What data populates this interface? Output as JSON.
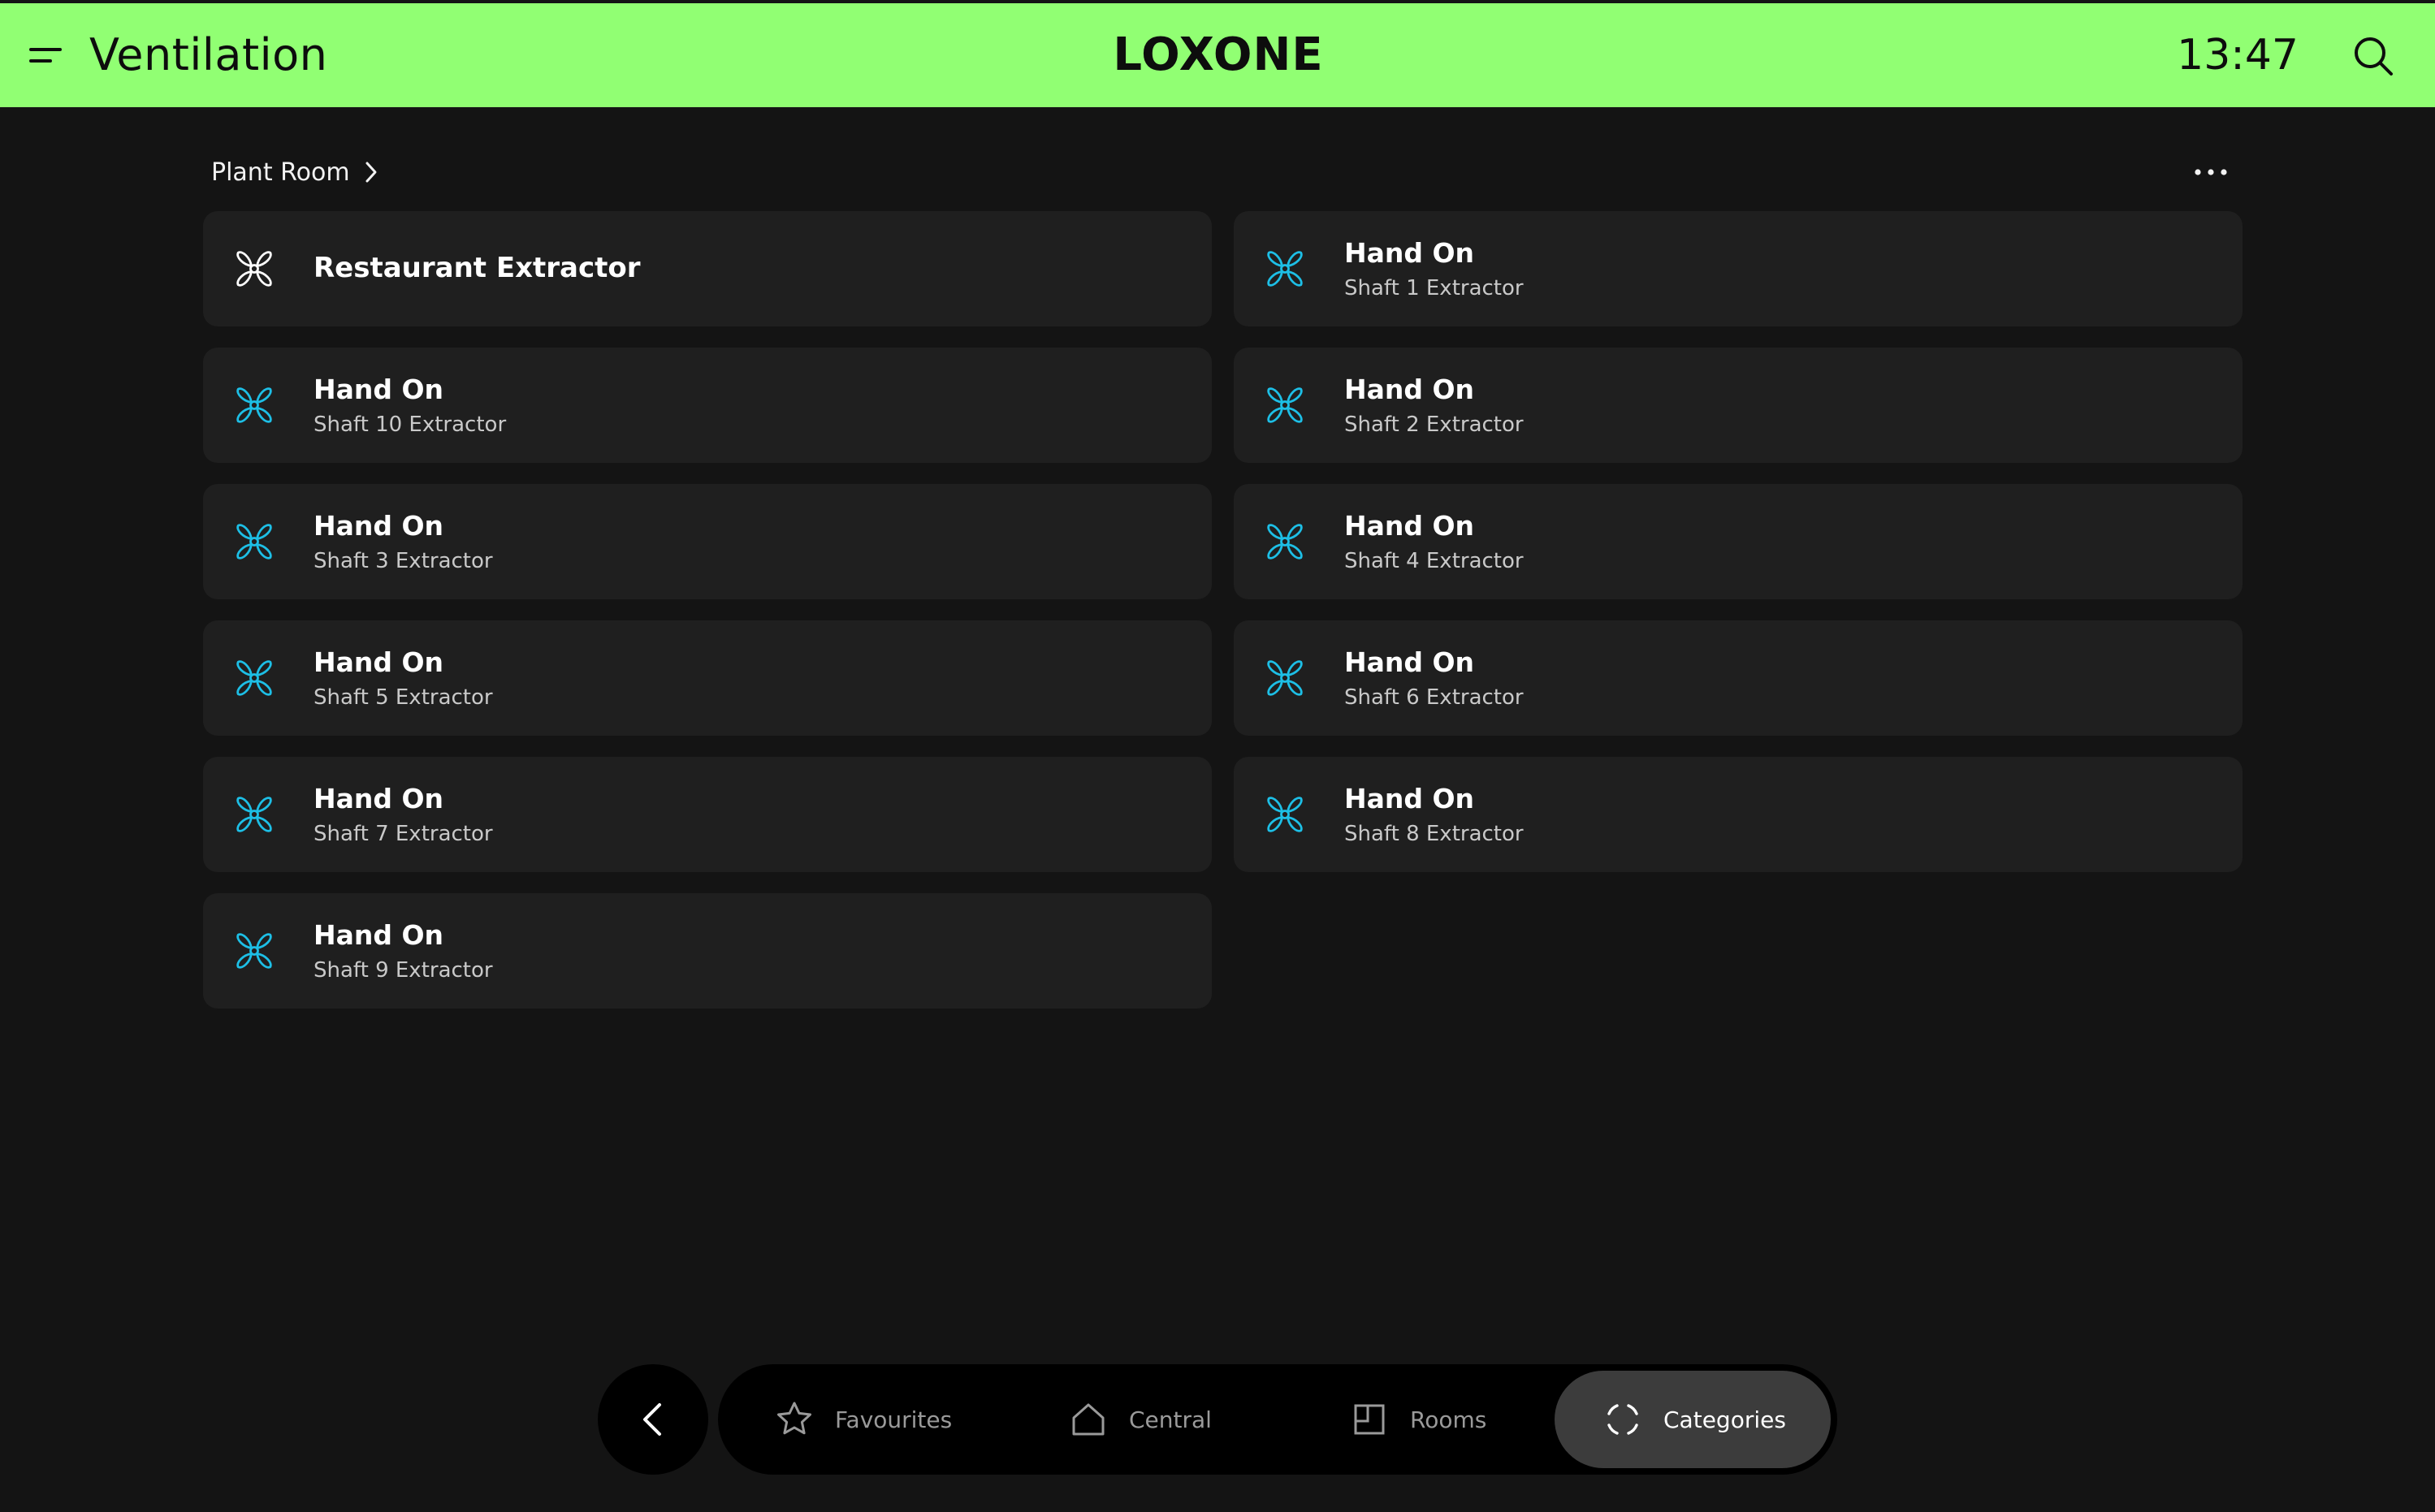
{
  "header": {
    "title": "Ventilation",
    "logo": "LOXONE",
    "time": "13:47",
    "background_color": "#91ff73",
    "menu_icon": "hamburger-menu-icon",
    "search_icon": "search-icon"
  },
  "breadcrumb": {
    "label": "Plant Room",
    "icon": "chevron-right-icon"
  },
  "more_icon": "more-dots-icon",
  "accent_color": "#1dbfe6",
  "tiles": [
    {
      "title": "Restaurant Extractor",
      "subtitle": "",
      "state": "off"
    },
    {
      "title": "Hand On",
      "subtitle": "Shaft 1 Extractor",
      "state": "on"
    },
    {
      "title": "Hand On",
      "subtitle": "Shaft 10 Extractor",
      "state": "on"
    },
    {
      "title": "Hand On",
      "subtitle": "Shaft 2 Extractor",
      "state": "on"
    },
    {
      "title": "Hand On",
      "subtitle": "Shaft 3 Extractor",
      "state": "on"
    },
    {
      "title": "Hand On",
      "subtitle": "Shaft 4 Extractor",
      "state": "on"
    },
    {
      "title": "Hand On",
      "subtitle": "Shaft 5 Extractor",
      "state": "on"
    },
    {
      "title": "Hand On",
      "subtitle": "Shaft 6 Extractor",
      "state": "on"
    },
    {
      "title": "Hand On",
      "subtitle": "Shaft 7 Extractor",
      "state": "on"
    },
    {
      "title": "Hand On",
      "subtitle": "Shaft 8 Extractor",
      "state": "on"
    },
    {
      "title": "Hand On",
      "subtitle": "Shaft 9 Extractor",
      "state": "on"
    }
  ],
  "bottom_nav": {
    "back_icon": "chevron-left-icon",
    "items": [
      {
        "label": "Favourites",
        "icon": "star-icon",
        "active": false
      },
      {
        "label": "Central",
        "icon": "home-icon",
        "active": false
      },
      {
        "label": "Rooms",
        "icon": "room-icon",
        "active": false
      },
      {
        "label": "Categories",
        "icon": "categories-icon",
        "active": true
      }
    ]
  }
}
